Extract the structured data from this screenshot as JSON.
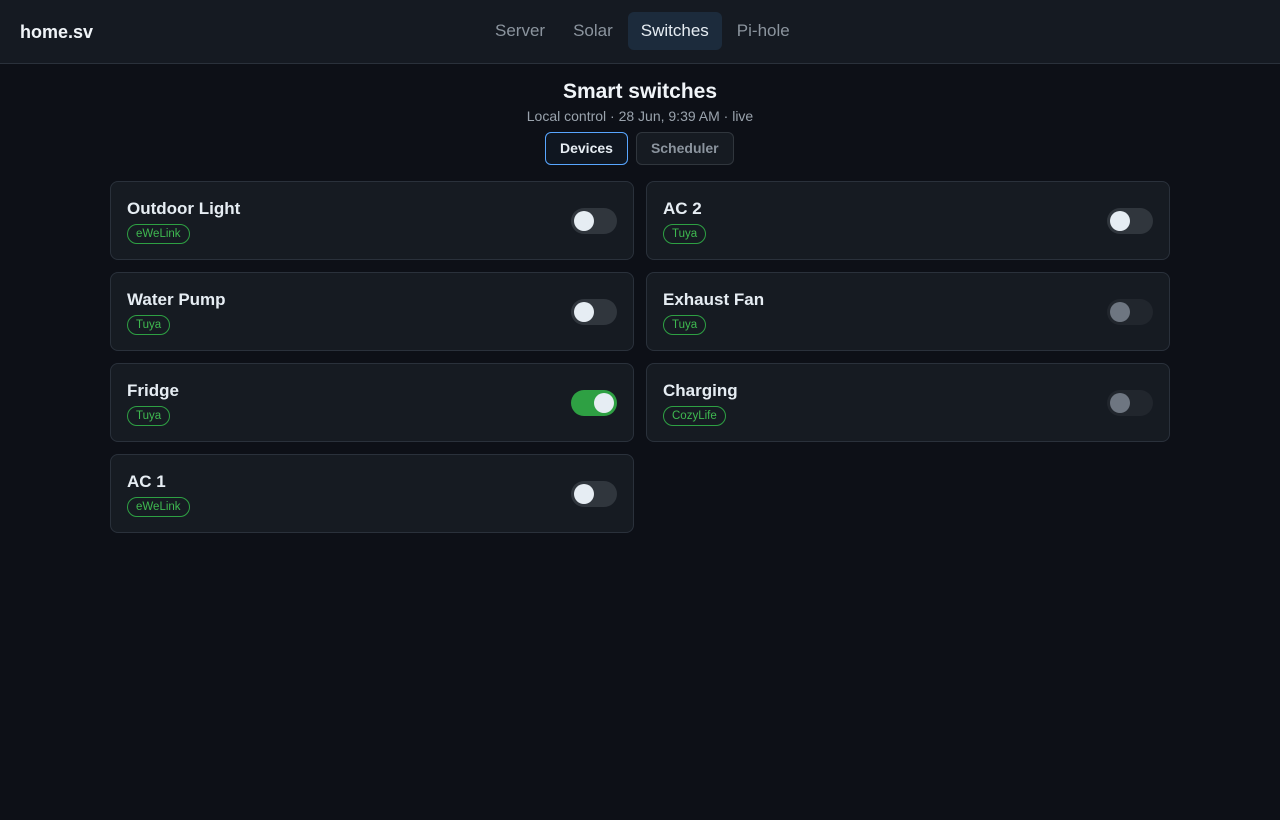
{
  "header": {
    "brand": "home.sv",
    "nav": [
      {
        "label": "Server",
        "active": false
      },
      {
        "label": "Solar",
        "active": false
      },
      {
        "label": "Switches",
        "active": true
      },
      {
        "label": "Pi-hole",
        "active": false
      }
    ]
  },
  "page": {
    "title": "Smart switches",
    "subtitle": "Local control · 28 Jun, 9:39 AM · live",
    "tabs": [
      {
        "label": "Devices",
        "active": true
      },
      {
        "label": "Scheduler",
        "active": false
      }
    ]
  },
  "devices": [
    {
      "name": "Outdoor Light",
      "platform": "eWeLink",
      "state": "off"
    },
    {
      "name": "AC 2",
      "platform": "Tuya",
      "state": "off"
    },
    {
      "name": "Water Pump",
      "platform": "Tuya",
      "state": "off"
    },
    {
      "name": "Exhaust Fan",
      "platform": "Tuya",
      "state": "unavailable"
    },
    {
      "name": "Fridge",
      "platform": "Tuya",
      "state": "on"
    },
    {
      "name": "Charging",
      "platform": "CozyLife",
      "state": "unavailable"
    },
    {
      "name": "AC 1",
      "platform": "eWeLink",
      "state": "off"
    }
  ],
  "colors": {
    "background": "#0d1017",
    "accent_green": "#2ea043",
    "accent_blue": "#58a6ff"
  }
}
